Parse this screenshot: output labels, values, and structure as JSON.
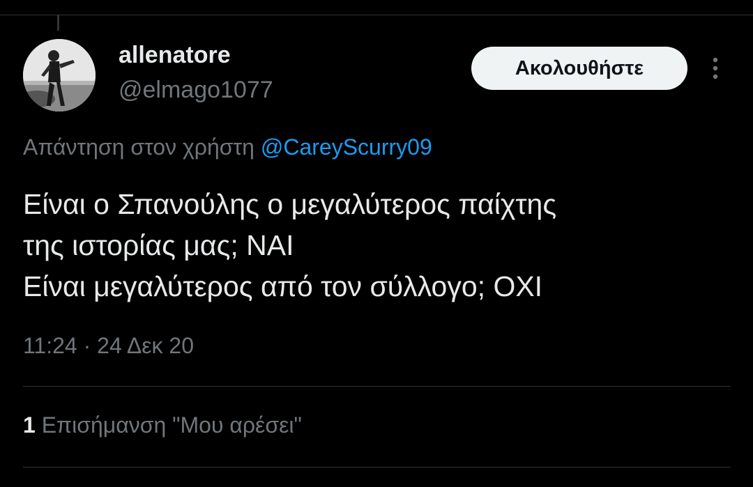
{
  "tweet": {
    "author": {
      "display_name": "allenatore",
      "handle": "@elmago1077"
    },
    "follow_label": "Ακολουθήστε",
    "reply_prefix": "Απάντηση στον χρήστη",
    "reply_to": "@CareyScurry09",
    "text_lines": [
      "Είναι ο Σπανούλης ο μεγαλύτερος παίχτης",
      "της ιστορίας μας; ΝΑΙ",
      "Είναι μεγαλύτερος από τον σύλλογο; ΟΧΙ"
    ],
    "timestamp": "11:24 · 24 Δεκ 20",
    "likes": {
      "count": "1",
      "label": "Επισήμανση \"Μου αρέσει\""
    }
  },
  "icons": {
    "avatar": "profile-photo",
    "more": "more-vertical-icon"
  },
  "colors": {
    "background": "#000000",
    "text_primary": "#e7e9ea",
    "text_secondary": "#71767b",
    "link": "#1d9bf0",
    "divider": "#2f3336",
    "follow_button_bg": "#eff3f4",
    "follow_button_text": "#0f1419"
  }
}
